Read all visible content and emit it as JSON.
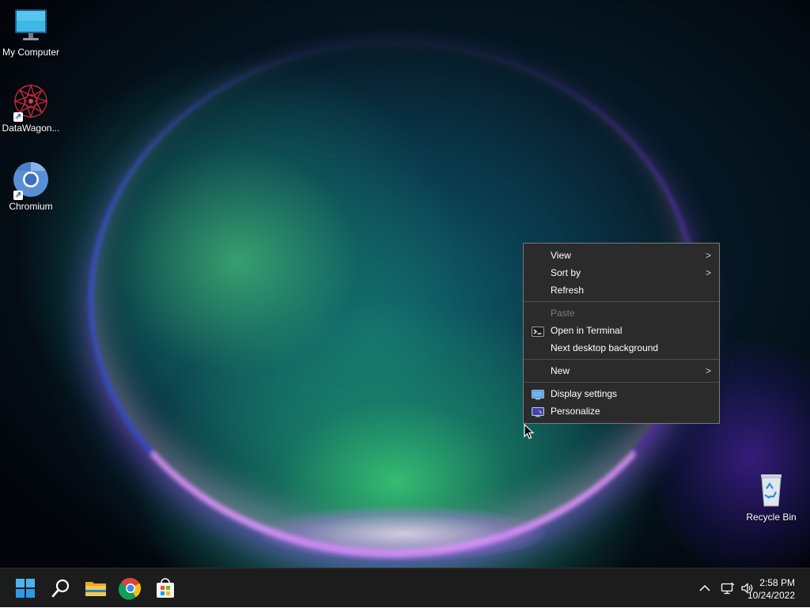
{
  "desktop": {
    "icons": [
      {
        "label": "My Computer",
        "icon": "monitor-icon"
      },
      {
        "label": "DataWagon...",
        "icon": "datawagon-icon",
        "shortcut": true
      },
      {
        "label": "Chromium",
        "icon": "chromium-icon",
        "shortcut": true
      },
      {
        "label": "Recycle Bin",
        "icon": "recycle-bin-icon"
      }
    ]
  },
  "context_menu": {
    "items": [
      {
        "label": "View",
        "submenu": true
      },
      {
        "label": "Sort by",
        "submenu": true
      },
      {
        "label": "Refresh"
      },
      {
        "label": "Paste",
        "disabled": true
      },
      {
        "label": "Open in Terminal",
        "icon": "terminal-icon"
      },
      {
        "label": "Next desktop background"
      },
      {
        "label": "New",
        "submenu": true
      },
      {
        "label": "Display settings",
        "icon": "display-settings-icon"
      },
      {
        "label": "Personalize",
        "icon": "personalize-icon"
      }
    ],
    "submenu_glyph": ">"
  },
  "taskbar": {
    "apps": [
      "start-icon",
      "search-icon",
      "file-explorer-icon",
      "chrome-icon",
      "store-icon"
    ],
    "tray_icons": [
      "chevron-up-icon",
      "network-icon",
      "volume-icon"
    ],
    "time": "2:58 PM",
    "date": "10/24/2022"
  },
  "colors": {
    "menu_bg": "#2b2b2b",
    "menu_border": "#7a7a7a",
    "taskbar_bg": "#1c1c1c",
    "accent": "#0078d4"
  }
}
